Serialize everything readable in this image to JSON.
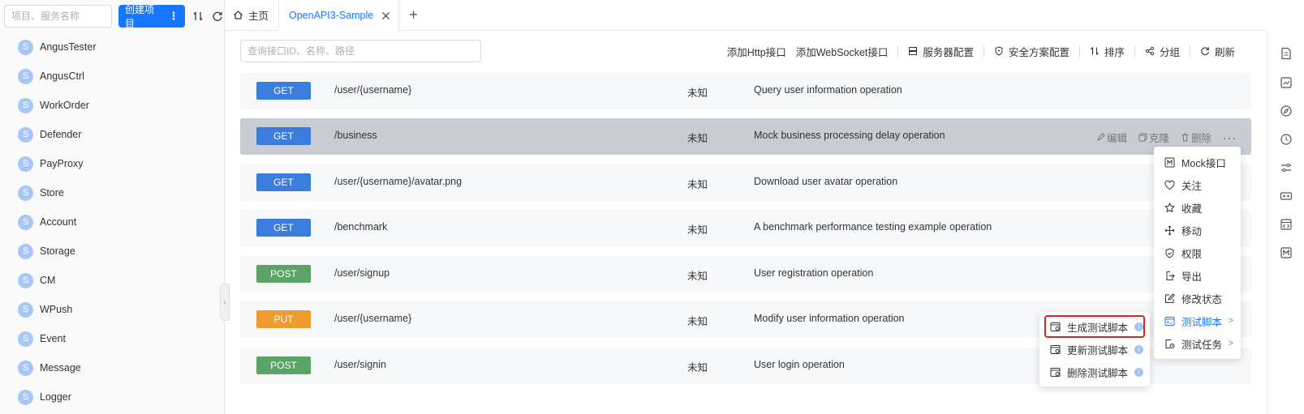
{
  "sidebar": {
    "search_placeholder": "项目、服务名称",
    "create_label": "创建项目",
    "items": [
      {
        "letter": "S",
        "label": "AngusTester"
      },
      {
        "letter": "S",
        "label": "AngusCtrl"
      },
      {
        "letter": "S",
        "label": "WorkOrder"
      },
      {
        "letter": "S",
        "label": "Defender"
      },
      {
        "letter": "S",
        "label": "PayProxy"
      },
      {
        "letter": "S",
        "label": "Store"
      },
      {
        "letter": "S",
        "label": "Account"
      },
      {
        "letter": "S",
        "label": "Storage"
      },
      {
        "letter": "S",
        "label": "CM"
      },
      {
        "letter": "S",
        "label": "WPush"
      },
      {
        "letter": "S",
        "label": "Event"
      },
      {
        "letter": "S",
        "label": "Message"
      },
      {
        "letter": "S",
        "label": "Logger"
      }
    ]
  },
  "tabs": {
    "home": "主页",
    "active": "OpenAPI3-Sample"
  },
  "toolbar": {
    "search_placeholder": "查询接口ID、名称、路径",
    "add_http": "添加Http接口",
    "add_ws": "添加WebSocket接口",
    "server_config": "服务器配置",
    "security_config": "安全方案配置",
    "sort": "排序",
    "group": "分组",
    "refresh": "刷新"
  },
  "apis": [
    {
      "method": "GET",
      "path": "/user/{username}",
      "status": "未知",
      "summary": "Query user information operation"
    },
    {
      "method": "GET",
      "path": "/business",
      "status": "未知",
      "summary": "Mock business processing delay operation"
    },
    {
      "method": "GET",
      "path": "/user/{username}/avatar.png",
      "status": "未知",
      "summary": "Download user avatar operation"
    },
    {
      "method": "GET",
      "path": "/benchmark",
      "status": "未知",
      "summary": "A benchmark performance testing example operation"
    },
    {
      "method": "POST",
      "path": "/user/signup",
      "status": "未知",
      "summary": "User registration operation"
    },
    {
      "method": "PUT",
      "path": "/user/{username}",
      "status": "未知",
      "summary": "Modify user information operation"
    },
    {
      "method": "POST",
      "path": "/user/signin",
      "status": "未知",
      "summary": "User login operation"
    }
  ],
  "row_actions": {
    "edit": "编辑",
    "clone": "克隆",
    "delete": "删除",
    "more": "···"
  },
  "menu": {
    "items": [
      {
        "icon": "mock-icon",
        "label": "Mock接口"
      },
      {
        "icon": "heart-icon",
        "label": "关注"
      },
      {
        "icon": "star-icon",
        "label": "收藏"
      },
      {
        "icon": "move-icon",
        "label": "移动"
      },
      {
        "icon": "shield-icon",
        "label": "权限"
      },
      {
        "icon": "export-icon",
        "label": "导出"
      },
      {
        "icon": "edit-status-icon",
        "label": "修改状态"
      },
      {
        "icon": "script-icon",
        "label": "测试脚本"
      },
      {
        "icon": "task-icon",
        "label": "测试任务"
      }
    ]
  },
  "submenu": {
    "items": [
      {
        "label": "生成测试脚本"
      },
      {
        "label": "更新测试脚本"
      },
      {
        "label": "删除测试脚本"
      }
    ]
  },
  "colors": {
    "accent": "#1677ff",
    "get": "#3b7ddd",
    "post": "#5ba468",
    "put": "#ee9b30",
    "highlight": "#d9261c"
  }
}
